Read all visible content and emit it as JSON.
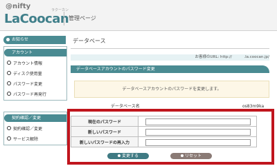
{
  "header": {
    "brand_small": "@nifty",
    "brand_main": "LaCoocan",
    "brand_ruby": "ラクーカン",
    "title": "管理ページ"
  },
  "sidebar": {
    "notice_label": "お知らせ",
    "account": {
      "title": "アカウント",
      "items": [
        "アカウント情報",
        "ディスク使用量",
        "パスワード変更",
        "パスワード再発行"
      ]
    },
    "contract": {
      "title": "契約確認／変更",
      "items": [
        "契約確認／変更",
        "サービス解除"
      ]
    }
  },
  "main": {
    "title": "データベース",
    "url_text": "お客様のURL: http://          .la.coocan.jp/",
    "section_title": "データベースアカウントのパスワード変更",
    "notice": "データベースアカウントのパスワードを変更します。",
    "db_name_label": "データベース名",
    "db_name_value": "os83m9ka"
  },
  "form": {
    "rows": [
      {
        "label": "現在のパスワード",
        "value": ""
      },
      {
        "label": "新しいパスワード",
        "value": ""
      },
      {
        "label": "新しいパスワードの再入力",
        "value": ""
      }
    ],
    "submit_label": "変更する",
    "reset_label": "リセット"
  },
  "colors": {
    "accent": "#4a8b92",
    "highlight": "#c0151d"
  }
}
